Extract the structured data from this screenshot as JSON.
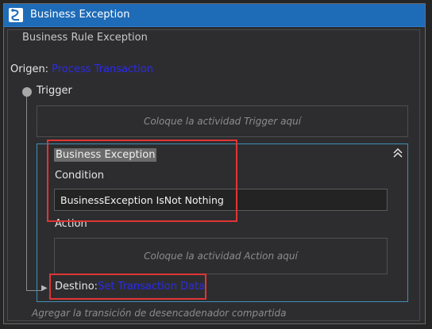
{
  "window": {
    "title": "Business Exception"
  },
  "subtitle": "Business Rule Exception",
  "origin": {
    "label": "Origen:",
    "value": "Process Transaction"
  },
  "trigger": {
    "label": "Trigger",
    "placeholder": "Coloque la actividad Trigger aquí"
  },
  "transition": {
    "name": "Business Exception",
    "condition_label": "Condition",
    "condition_value": "BusinessException IsNot Nothing",
    "action_label": "Action",
    "action_placeholder": "Coloque la actividad Action aquí",
    "destination_label": "Destino:",
    "destination_value": "Set Transaction Data"
  },
  "footer": "Agregar la transición de desencadenador compartida",
  "colors": {
    "title_bar": "#1e6bb8",
    "link": "#2a2af0",
    "highlight": "#e03535",
    "transition_border": "#3f8fb5"
  },
  "icons": [
    "state-machine-icon",
    "collapse-chevrons-icon",
    "arrow-right-icon"
  ]
}
